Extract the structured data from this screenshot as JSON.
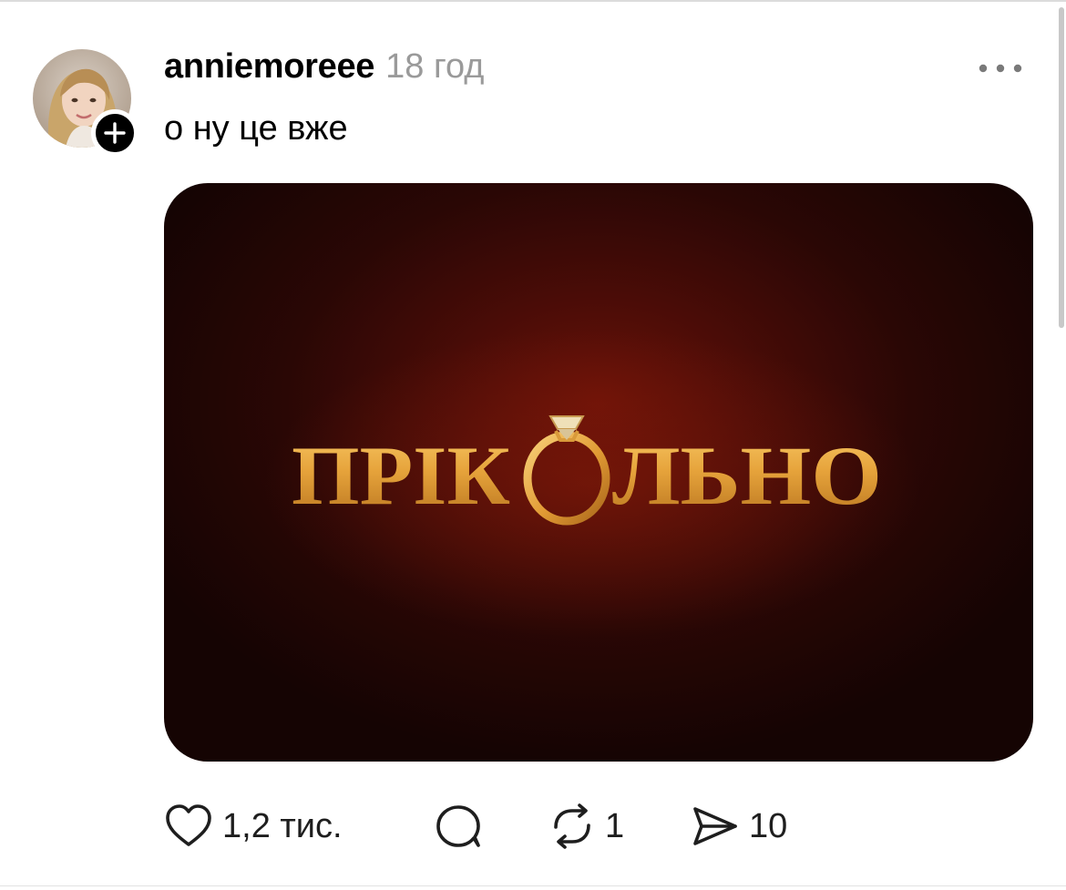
{
  "post": {
    "username": "anniemoreee",
    "time": "18 год",
    "text": "о ну це вже",
    "image_title": "ПРІКОЛЬНО"
  },
  "actions": {
    "likes": "1,2 тис.",
    "reposts": "1",
    "shares": "10"
  },
  "icons": {
    "follow": "plus-icon",
    "more": "more-horizontal-icon",
    "like": "heart-icon",
    "reply": "comment-icon",
    "repost": "repost-icon",
    "share": "send-icon"
  },
  "colors": {
    "title_gold": "#e0a23a",
    "image_bg": "#2a0705",
    "meta_gray": "#9a9a9a"
  }
}
